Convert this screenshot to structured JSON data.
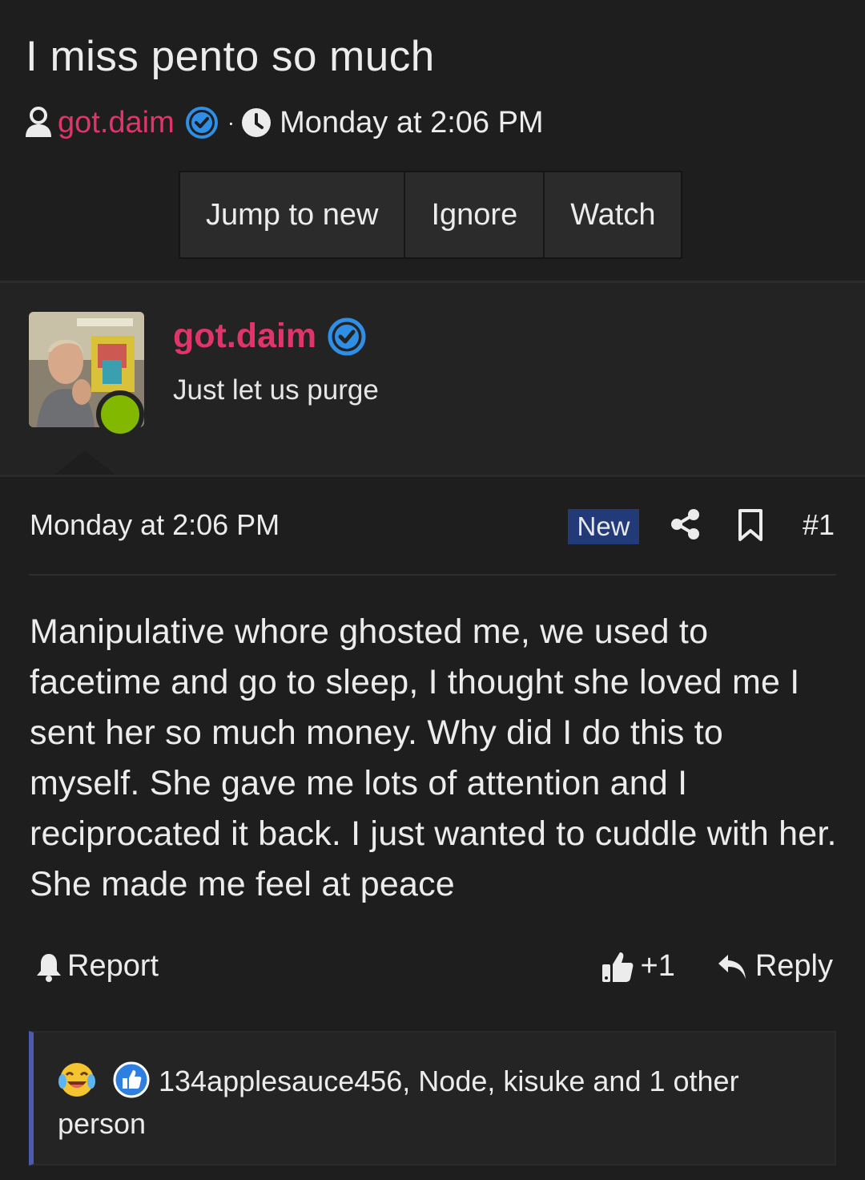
{
  "thread": {
    "title": "I miss pento so much",
    "author": "got.daim",
    "separator": "·",
    "date": "Monday at 2:06 PM",
    "buttons": {
      "jump_to_new": "Jump to new",
      "ignore": "Ignore",
      "watch": "Watch"
    }
  },
  "author_block": {
    "username": "got.daim",
    "user_title": "Just let us purge",
    "status": "online"
  },
  "post": {
    "date": "Monday at 2:06 PM",
    "new_badge": "New",
    "number": "#1",
    "body": "Manipulative whore ghosted me, we used to facetime and go to sleep, I thought she loved me I sent her so much money. Why did I do this to myself. She gave me lots of attention and I reciprocated it back. I just wanted to cuddle with her. She made me feel at peace",
    "actions": {
      "report": "Report",
      "like_count": "+1",
      "reply": "Reply"
    }
  },
  "reactions": {
    "icons": [
      "laughing-tears-emoji",
      "thumbs-up-reaction-icon"
    ],
    "text": "134applesauce456, Node, kisuke and 1 other person"
  },
  "colors": {
    "background": "#1e1e1e",
    "username": "#e0356b",
    "verified": "#2f8ee6",
    "online": "#83b800",
    "new_badge": "#233a78",
    "reaction_border": "#4a5bb0"
  }
}
